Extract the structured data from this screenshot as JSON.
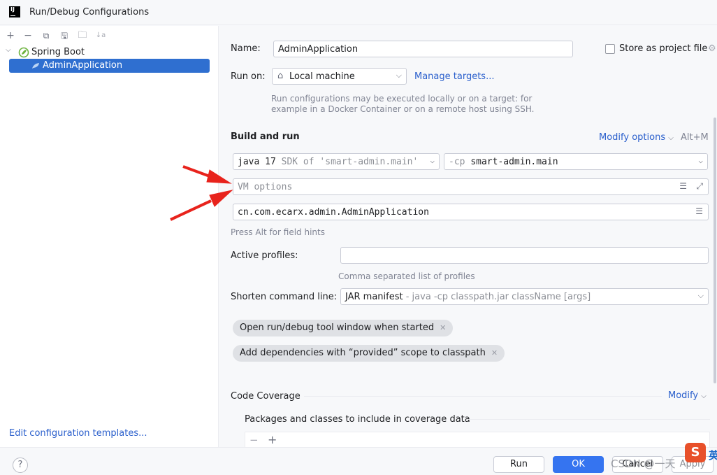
{
  "window": {
    "title": "Run/Debug Configurations",
    "logo_text": "IJ"
  },
  "toolbar": {
    "add": "+",
    "remove": "−",
    "copy": "⧉",
    "save": "🖫",
    "folder": "🗀",
    "sort": "↓a"
  },
  "tree": {
    "root_label": "Spring Boot",
    "child_label": "AdminApplication",
    "edit_templates_link": "Edit configuration templates..."
  },
  "form": {
    "name_label": "Name:",
    "name_value": "AdminApplication",
    "store_label": "Store as project file",
    "runon_label": "Run on:",
    "runon_value": "Local machine",
    "manage_targets": "Manage targets...",
    "runon_hint_1": "Run configurations may be executed locally or on a target: for",
    "runon_hint_2": "example in a Docker Container or on a remote host using SSH.",
    "build_section": "Build and run",
    "modify_options": "Modify options",
    "modify_shortcut": "Alt+M",
    "jdk_name": "java 17",
    "jdk_detail": "SDK of 'smart-admin.main'",
    "cp_prefix": "-cp",
    "cp_value": "smart-admin.main",
    "vm_placeholder": "VM options",
    "main_class": "cn.com.ecarx.admin.AdminApplication",
    "alt_hint": "Press Alt for field hints",
    "profiles_label": "Active profiles:",
    "profiles_value": "",
    "profiles_hint": "Comma separated list of profiles",
    "shorten_label": "Shorten command line:",
    "shorten_value": "JAR manifest",
    "shorten_detail": "- java -cp classpath.jar className [args]",
    "chip_1": "Open run/debug tool window when started",
    "chip_2": "Add dependencies with “provided” scope to classpath",
    "coverage_section": "Code Coverage",
    "coverage_modify": "Modify",
    "coverage_packages": "Packages and classes to include in coverage data"
  },
  "buttons": {
    "run": "Run",
    "ok": "OK",
    "cancel": "Cancel",
    "apply": "Apply",
    "help": "?"
  },
  "overlay": {
    "watermark": "CSDN @一天",
    "ime_badge": "S",
    "ime_text": "英"
  },
  "colors": {
    "accent": "#3574f0",
    "selection": "#2f6fd0",
    "link": "#2a5fcc",
    "arrow": "#e8231c",
    "spring": "#6db33f"
  }
}
